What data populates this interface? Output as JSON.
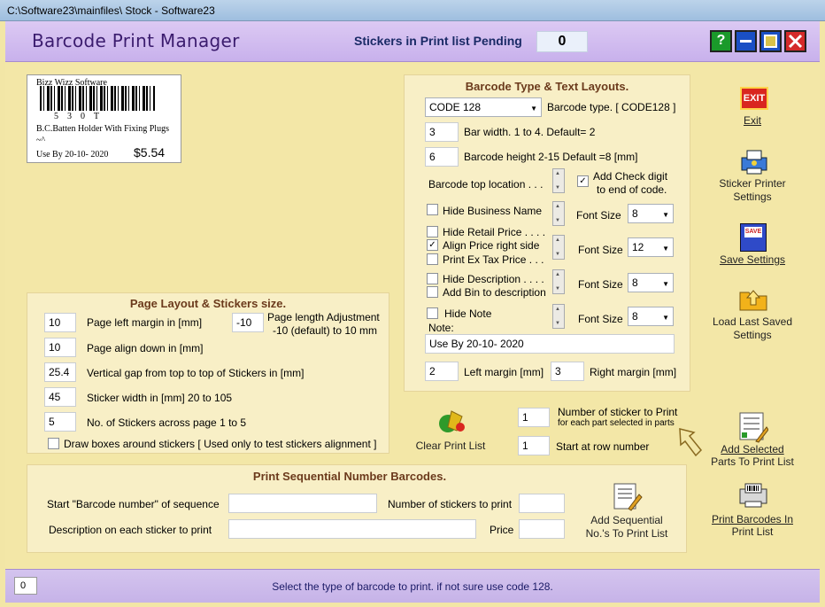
{
  "window": {
    "title": "C:\\Software23\\mainfiles\\ Stock - Software23"
  },
  "header": {
    "app_title": "Barcode Print Manager",
    "pending_label": "Stickers in Print list Pending",
    "pending_count": "0",
    "help": "?"
  },
  "preview": {
    "business": "Bizz Wizz Software",
    "digits": "5    3    0    T",
    "description": "B.C.Batten Holder With Fixing Plugs ~^",
    "use_by": "Use By 20-10- 2020",
    "price": "$5.54"
  },
  "barcode_panel": {
    "title": "Barcode Type & Text Layouts.",
    "type_value": "CODE 128",
    "type_label": "Barcode type. [ CODE128 ]",
    "bar_width_value": "3",
    "bar_width_label": "Bar width. 1 to 4.  Default= 2",
    "bar_height_value": "6",
    "bar_height_label": "Barcode height 2-15 Default =8 [mm]",
    "top_location_label": "Barcode top location . . .",
    "add_check_label": "Add Check digit",
    "add_check_label2": "to end of code.",
    "hide_business_label": "Hide Business Name",
    "font_size_label": "Font Size",
    "font1": "8",
    "hide_retail_label": "Hide Retail Price . . . .",
    "align_price_label": "Align Price right side",
    "print_ex_tax_label": "Print Ex Tax  Price . . .",
    "font2": "12",
    "hide_desc_label": "Hide Description . . . .",
    "add_bin_label": "Add Bin to description",
    "font3": "8",
    "hide_note_label": "Hide Note",
    "note_label": "Note:",
    "font4": "8",
    "note_value": "Use By 20-10- 2020",
    "left_margin_value": "2",
    "left_margin_label": "Left margin [mm]",
    "right_margin_value": "3",
    "right_margin_label": "Right margin [mm]"
  },
  "page_layout": {
    "title": "Page Layout & Stickers size.",
    "left_margin_value": "10",
    "left_margin_label": "Page left margin in [mm]",
    "length_adj_value": "-10",
    "length_adj_label": "Page length Adjustment",
    "length_adj_label2": "-10 (default)  to 10 mm",
    "align_down_value": "10",
    "align_down_label": "Page align down in [mm]",
    "vgap_value": "25.4",
    "vgap_label": "Vertical gap from top to top of Stickers in [mm]",
    "width_value": "45",
    "width_label": "Sticker width in [mm]  20 to 105",
    "across_value": "5",
    "across_label": "No. of Stickers across page 1 to 5",
    "draw_boxes_label": "Draw boxes around stickers [ Used only to test stickers alignment ]"
  },
  "print_controls": {
    "clear_label": "Clear Print List",
    "num_sticker_value": "1",
    "num_sticker_label": "Number of sticker to Print",
    "num_sticker_sub": "for each part selected in parts",
    "start_row_value": "1",
    "start_row_label": "Start at row number"
  },
  "sequential": {
    "title": "Print Sequential Number Barcodes.",
    "start_label": "Start \"Barcode number\" of sequence",
    "num_print_label": "Number of stickers to print",
    "desc_label": "Description on each sticker to print",
    "price_label": "Price",
    "add_seq_label": "Add Sequential",
    "add_seq_label2": "No.'s To Print List"
  },
  "side_buttons": {
    "exit": "Exit",
    "exit_icon_text": "EXIT",
    "printer_settings": "Sticker Printer",
    "printer_settings2": "Settings",
    "save_settings": "Save Settings",
    "save_icon_text": "SAVE",
    "load_settings": "Load Last Saved",
    "load_settings2": "Settings",
    "add_selected": "Add Selected",
    "add_selected2": "Parts To Print List",
    "print_barcodes": "Print Barcodes In",
    "print_barcodes2": "Print List"
  },
  "status": {
    "count": "0",
    "message": "Select the type of barcode to print. if not sure use code 128."
  }
}
